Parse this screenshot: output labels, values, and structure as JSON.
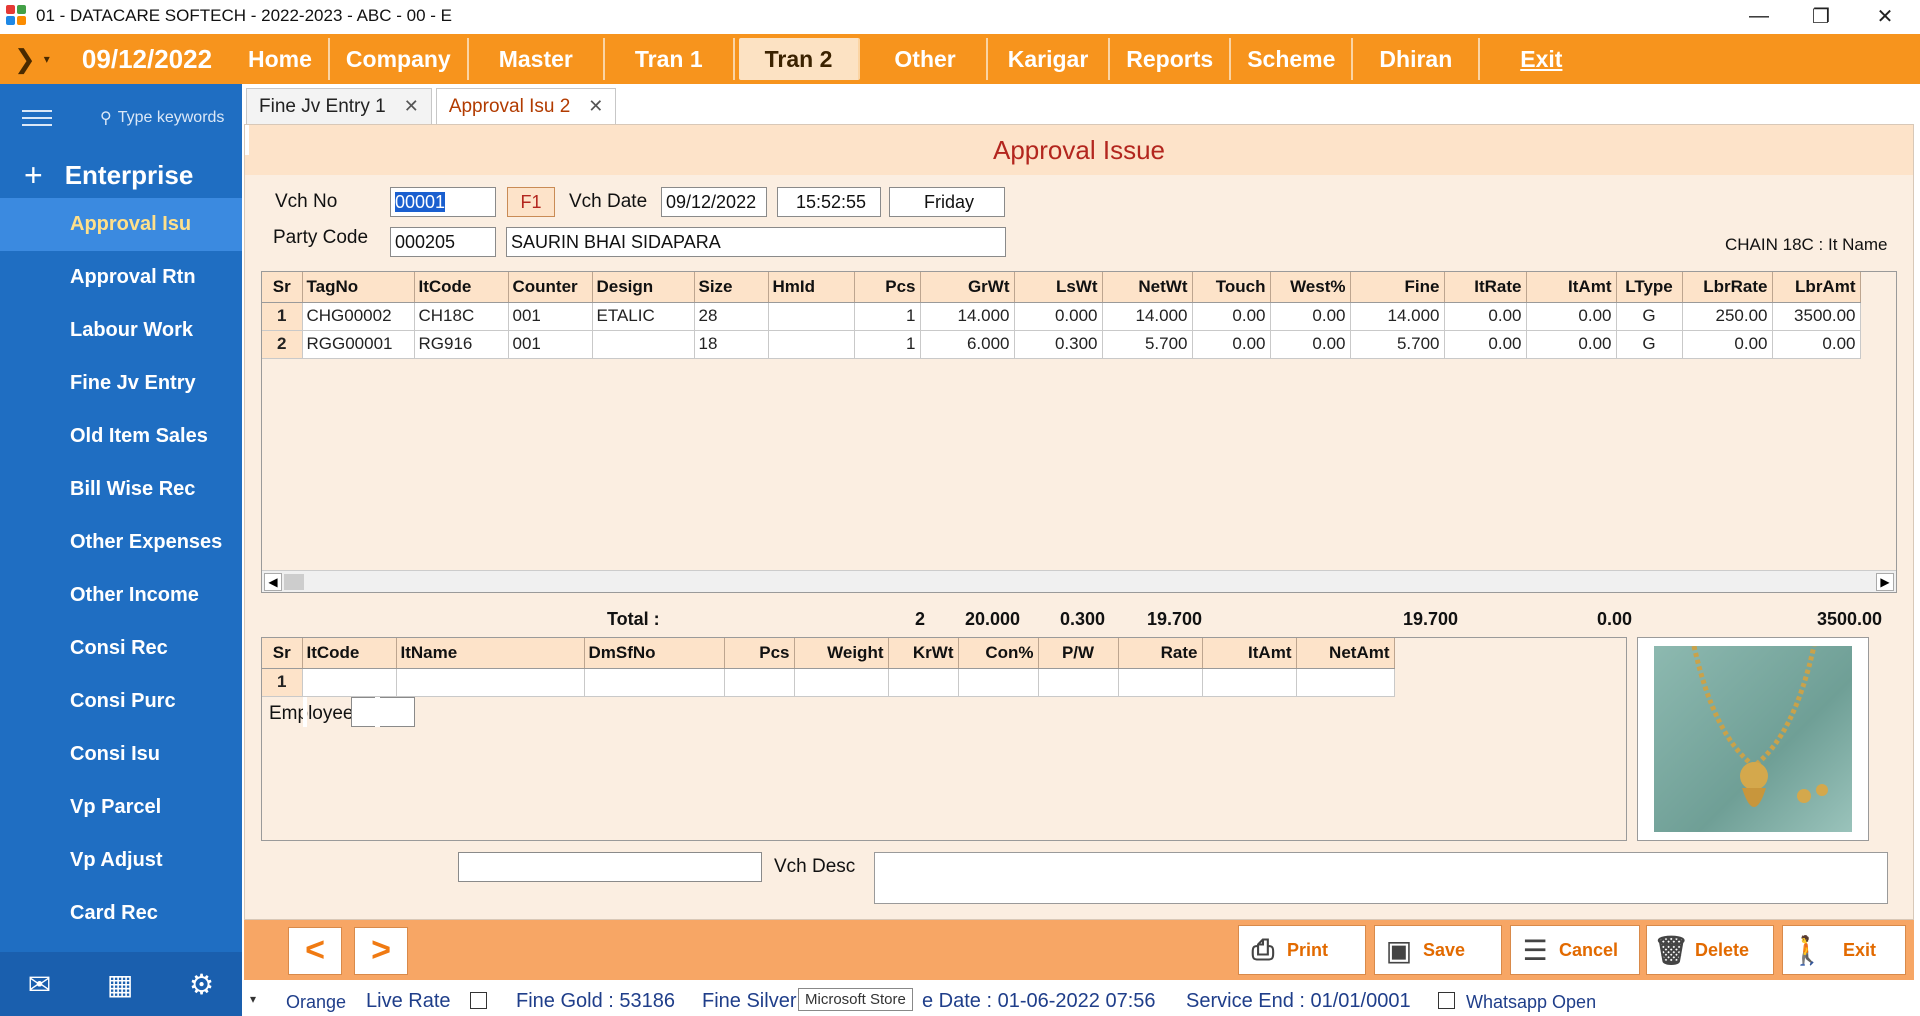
{
  "window": {
    "title": "01 - DATACARE SOFTECH - 2022-2023 - ABC - 00 - E",
    "minimize": "—",
    "restore": "❐",
    "close": "✕"
  },
  "menubar": {
    "date": "09/12/2022",
    "items": [
      "Home",
      "Company",
      "Master",
      "Tran 1",
      "Tran 2",
      "Other",
      "Karigar",
      "Reports",
      "Scheme",
      "Dhiran",
      "Exit"
    ],
    "active": "Tran 2",
    "accent": "#f7941d"
  },
  "sidebar": {
    "search_placeholder": "Type keywords",
    "section": "Enterprise",
    "items": [
      "Approval Isu",
      "Approval Rtn",
      "Labour Work",
      "Fine Jv Entry",
      "Old Item Sales",
      "Bill Wise Rec",
      "Other Expenses",
      "Other Income",
      "Consi Rec",
      "Consi Purc",
      "Consi Isu",
      "Vp Parcel",
      "Vp Adjust",
      "Card Rec"
    ],
    "active": "Approval Isu",
    "color": "#1f6ec2"
  },
  "tabs": [
    {
      "label": "Fine Jv Entry 1"
    },
    {
      "label": "Approval Isu 2"
    }
  ],
  "form": {
    "title": "Approval Issue",
    "vch_no_label": "Vch No",
    "vch_no": "00001",
    "f1_label": "F1",
    "vch_date_label": "Vch Date",
    "vch_date": "09/12/2022",
    "vch_time": "15:52:55",
    "vch_day": "Friday",
    "party_code_label": "Party Code",
    "party_code": "000205",
    "party_name": "SAURIN BHAI SIDAPARA",
    "item_hint": "CHAIN 18C : It Name",
    "employee_label": "Employee",
    "vch_desc_label": "Vch Desc"
  },
  "items_grid": {
    "headers": [
      "Sr",
      "TagNo",
      "ItCode",
      "Counter",
      "Design",
      "Size",
      "HmId",
      "Pcs",
      "GrWt",
      "LsWt",
      "NetWt",
      "Touch",
      "West%",
      "Fine",
      "ItRate",
      "ItAmt",
      "LType",
      "LbrRate",
      "LbrAmt"
    ],
    "rows": [
      [
        "1",
        "CHG00002",
        "CH18C",
        "001",
        "ETALIC",
        "28",
        "",
        "1",
        "14.000",
        "0.000",
        "14.000",
        "0.00",
        "0.00",
        "14.000",
        "0.00",
        "0.00",
        "G",
        "250.00",
        "3500.00"
      ],
      [
        "2",
        "RGG00001",
        "RG916",
        "001",
        "",
        "18",
        "",
        "1",
        "6.000",
        "0.300",
        "5.700",
        "0.00",
        "0.00",
        "5.700",
        "0.00",
        "0.00",
        "G",
        "0.00",
        "0.00"
      ]
    ]
  },
  "totals": {
    "label": "Total :",
    "pcs": "2",
    "grwt": "20.000",
    "lswt": "0.300",
    "netwt": "19.700",
    "fine": "19.700",
    "itamt": "0.00",
    "lbramt": "3500.00"
  },
  "diamond_grid": {
    "headers": [
      "Sr",
      "ItCode",
      "ItName",
      "DmSfNo",
      "Pcs",
      "Weight",
      "KrWt",
      "Con%",
      "P/W",
      "Rate",
      "ItAmt",
      "NetAmt"
    ],
    "rows": [
      [
        "1",
        "",
        "",
        "",
        "",
        "",
        "",
        "",
        "",
        "",
        "",
        ""
      ]
    ]
  },
  "toolbar": {
    "prev": "<",
    "next": ">",
    "print": "Print",
    "save": "Save",
    "cancel": "Cancel",
    "delete": "Delete",
    "exit": "Exit"
  },
  "status": {
    "theme": "Orange",
    "live_rate": "Live Rate",
    "fine_gold": "Fine Gold : 53186",
    "fine_silver": "Fine Silver",
    "tooltip": "Microsoft Store",
    "date_text": "e Date : 01-06-2022 07:56",
    "service_end": "Service End :  01/01/0001",
    "whatsapp": "Whatsapp Open"
  }
}
